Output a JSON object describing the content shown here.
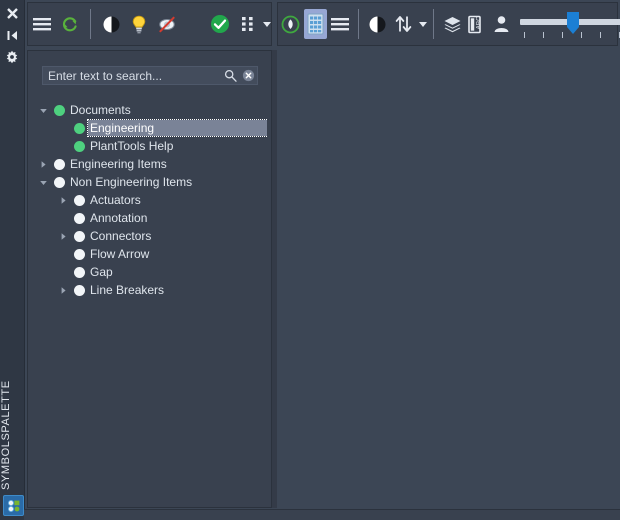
{
  "window": {
    "panel_title": "SYMBOLSPALETTE"
  },
  "vertical_sidebar": {
    "items": [
      {
        "name": "close-icon",
        "tooltip": "Close"
      },
      {
        "name": "pin-icon",
        "tooltip": "Auto Hide"
      },
      {
        "name": "gear-icon",
        "tooltip": "Options"
      }
    ],
    "bottom_item": {
      "name": "symbol-palette-icon",
      "tooltip": "Symbolspalette"
    }
  },
  "toolbar_left": {
    "buttons": [
      {
        "name": "menu-icon",
        "label": "Menu"
      },
      {
        "name": "refresh-icon",
        "label": "Refresh"
      },
      {
        "name": "contrast-icon",
        "label": "Contrast"
      },
      {
        "name": "lightbulb-icon",
        "label": "Highlight"
      },
      {
        "name": "hide-preview-icon",
        "label": "No Preview"
      },
      {
        "name": "check-circle-icon",
        "label": "Apply"
      },
      {
        "name": "grid-dots-icon",
        "label": "View Mode"
      }
    ]
  },
  "toolbar_right": {
    "buttons": [
      {
        "name": "circle-leaf-icon",
        "label": "Symbol"
      },
      {
        "name": "grid-view-icon",
        "label": "Grid View",
        "active": true
      },
      {
        "name": "list-view-icon",
        "label": "List View"
      },
      {
        "name": "contrast-icon",
        "label": "Contrast"
      },
      {
        "name": "sort-icon",
        "label": "Sort"
      },
      {
        "name": "layers-icon",
        "label": "Layers"
      },
      {
        "name": "abc-label-icon",
        "label": "Labels"
      },
      {
        "name": "user-icon",
        "label": "User"
      }
    ],
    "zoom_slider": {
      "name": "zoom-slider",
      "value": 50,
      "min": 0,
      "max": 100,
      "ticks": 6
    }
  },
  "search": {
    "placeholder": "Enter text to search...",
    "value": "",
    "search_icon": "search-icon",
    "clear_icon": "clear-icon"
  },
  "tree": {
    "nodes": [
      {
        "label": "Documents",
        "depth": 0,
        "dot": "green",
        "expander": "open",
        "selected": false
      },
      {
        "label": "Engineering",
        "depth": 1,
        "dot": "green",
        "expander": "none",
        "selected": true
      },
      {
        "label": "PlantTools Help",
        "depth": 1,
        "dot": "green",
        "expander": "none",
        "selected": false
      },
      {
        "label": "Engineering Items",
        "depth": 0,
        "dot": "white",
        "expander": "closed",
        "selected": false
      },
      {
        "label": "Non Engineering Items",
        "depth": 0,
        "dot": "white",
        "expander": "open",
        "selected": false
      },
      {
        "label": "Actuators",
        "depth": 1,
        "dot": "white",
        "expander": "closed",
        "selected": false
      },
      {
        "label": "Annotation",
        "depth": 1,
        "dot": "white",
        "expander": "none",
        "selected": false
      },
      {
        "label": "Connectors",
        "depth": 1,
        "dot": "white",
        "expander": "closed",
        "selected": false
      },
      {
        "label": "Flow Arrow",
        "depth": 1,
        "dot": "white",
        "expander": "none",
        "selected": false
      },
      {
        "label": "Gap",
        "depth": 1,
        "dot": "white",
        "expander": "none",
        "selected": false
      },
      {
        "label": "Line Breakers",
        "depth": 1,
        "dot": "white",
        "expander": "closed",
        "selected": false
      }
    ]
  },
  "colors": {
    "background": "#3c4655",
    "panel": "#39414f",
    "sidebar": "#2f3744",
    "accent_green": "#4ed07f",
    "accent_blue": "#1b7fd4",
    "active_tool": "#97a7d4",
    "text": "#dfe5ec"
  }
}
